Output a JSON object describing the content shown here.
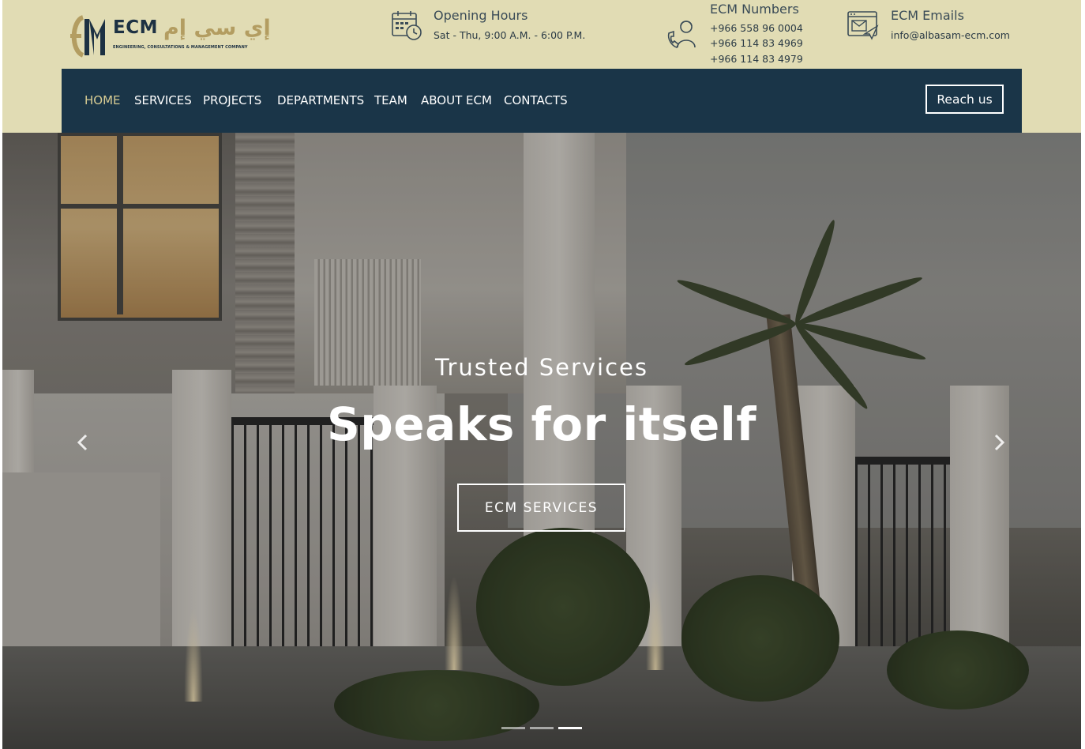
{
  "logo": {
    "en": "ECM",
    "ar": "إي سي إم",
    "tagline": "ENGINEERING, CONSULTATIONS & MANAGEMENT COMPANY"
  },
  "info": {
    "hours": {
      "title": "Opening Hours",
      "line": "Sat - Thu, 9:00 A.M. - 6:00 P.M.",
      "icon": "calendar-clock-icon"
    },
    "numbers": {
      "title": "ECM Numbers",
      "lines": [
        "+966 558 96 0004",
        "+966 114 83 4969",
        "+966 114 83 4979"
      ],
      "icon": "support-agent-icon"
    },
    "emails": {
      "title": "ECM Emails",
      "line": "info@albasam-ecm.com",
      "icon": "email-icon"
    }
  },
  "nav": {
    "items": [
      "HOME",
      "SERVICES",
      "PROJECTS",
      "DEPARTMENTS",
      "TEAM",
      "ABOUT ECM",
      "CONTACTS"
    ],
    "active_index": 0,
    "cta": "Reach us"
  },
  "hero": {
    "subtitle": "Trusted Services",
    "title": "Speaks for itself",
    "button": "ECM SERVICES",
    "prev_icon": "chevron-left-icon",
    "next_icon": "chevron-right-icon",
    "indicator_count": 3,
    "active_indicator": 2
  },
  "colors": {
    "header_bg": "#e1dcb4",
    "nav_bg": "#1a3548",
    "nav_active": "#d8cc93",
    "logo_navy": "#1d3143",
    "logo_gold": "#b39d61"
  }
}
